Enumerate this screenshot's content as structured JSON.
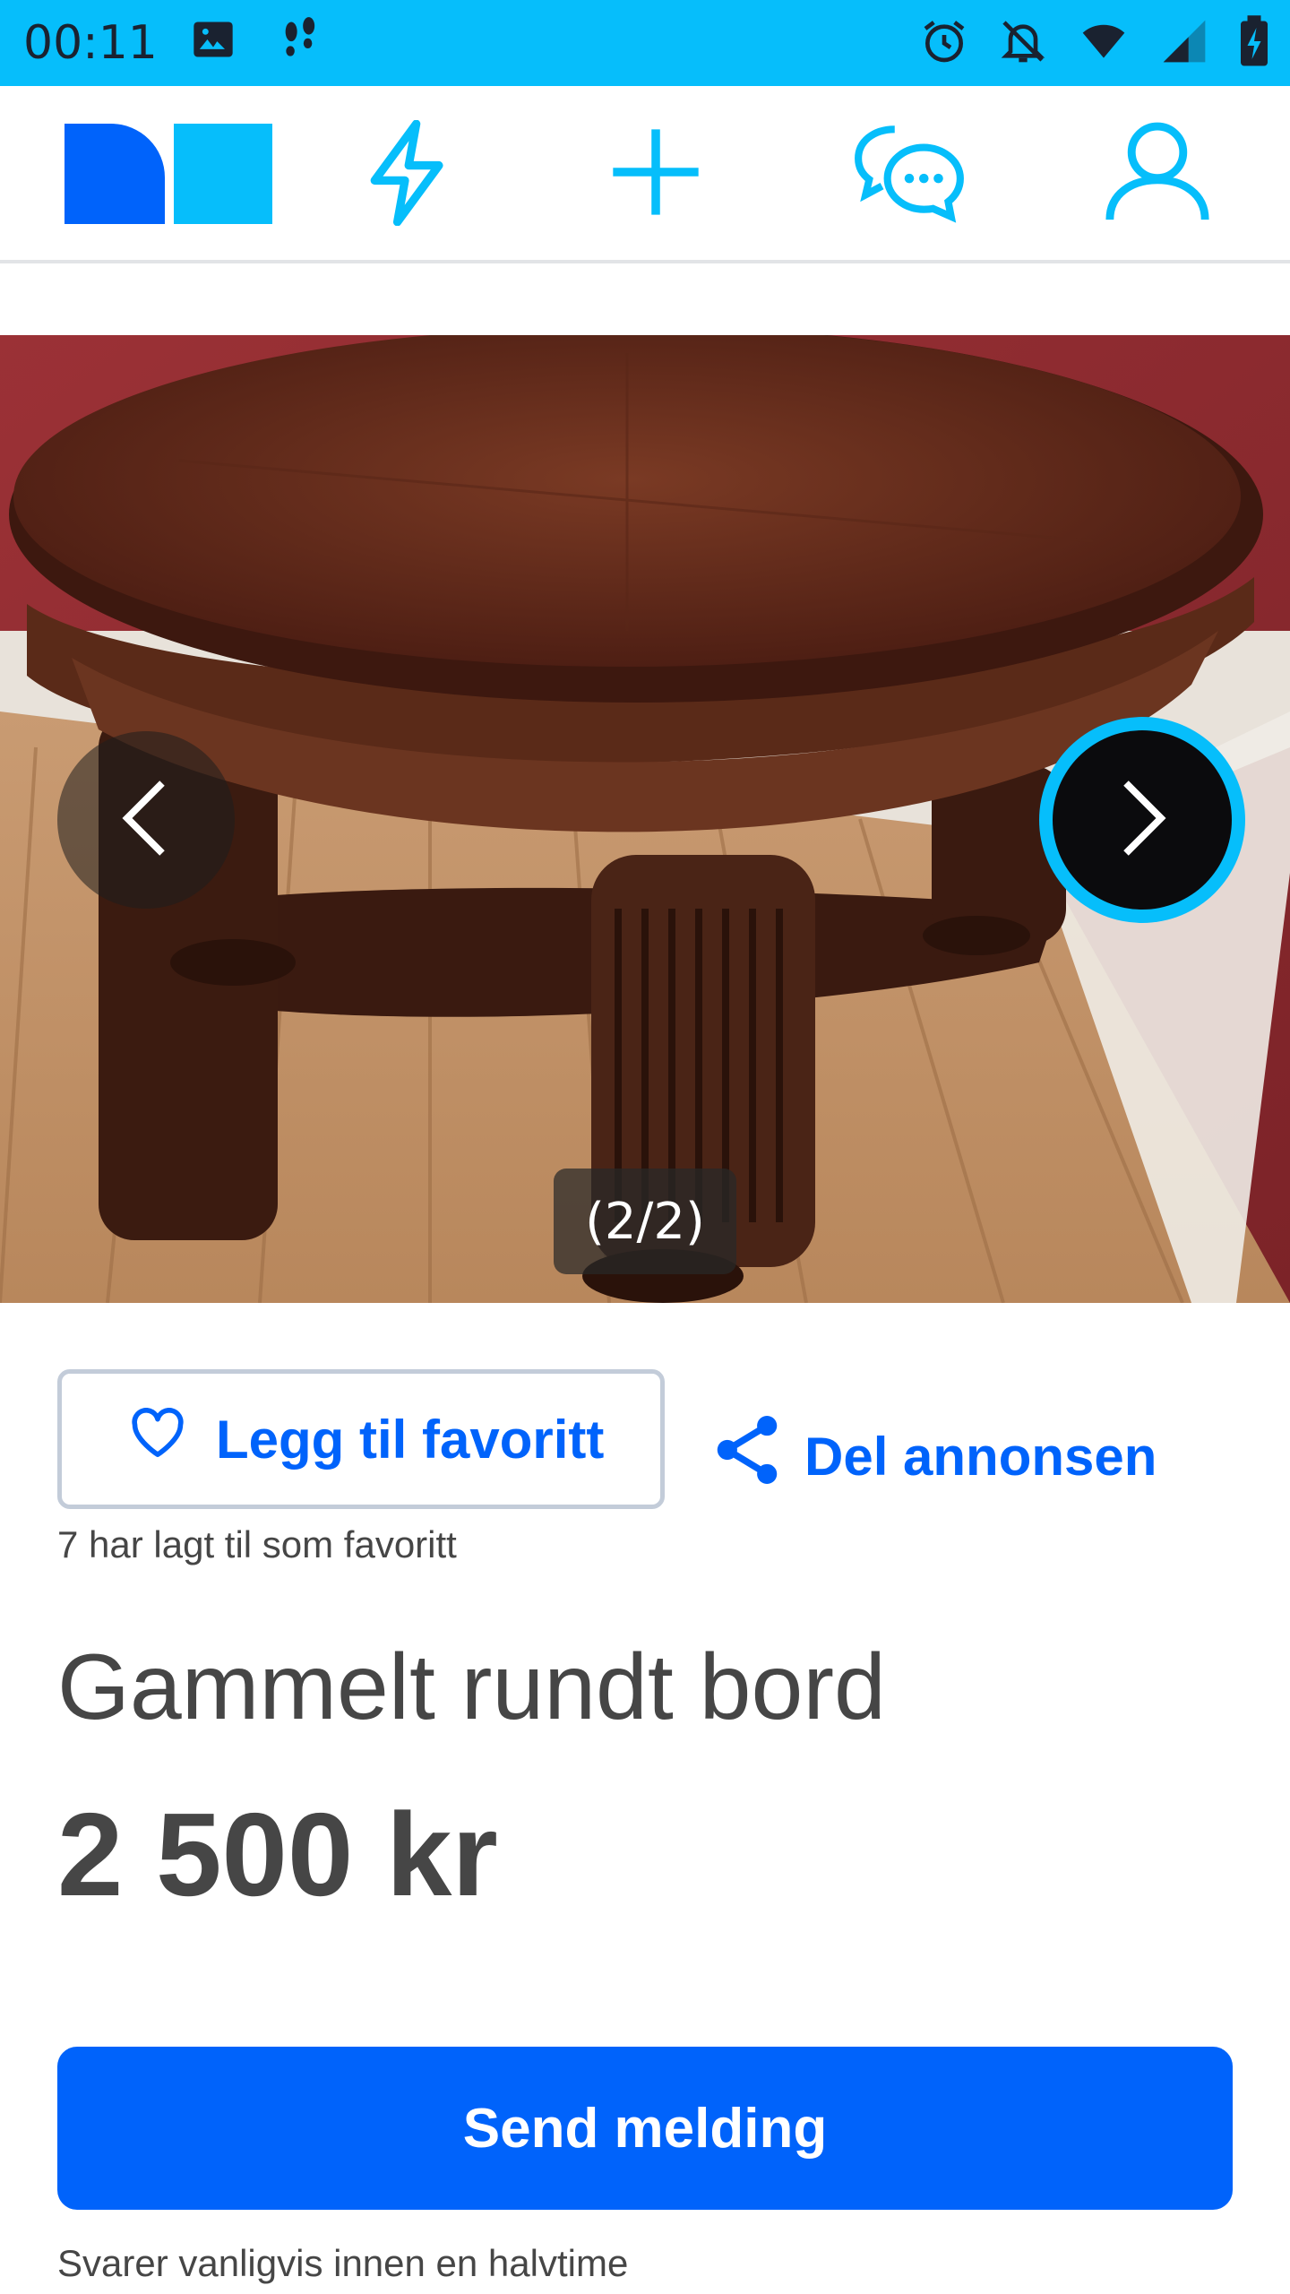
{
  "status_bar": {
    "time": "00:11",
    "left_icons": [
      "image-icon",
      "footsteps-icon"
    ],
    "right_icons": [
      "alarm-icon",
      "notifications-off-icon",
      "wifi-icon",
      "signal-icon",
      "battery-charging-icon"
    ]
  },
  "nav": {
    "items": [
      "home-logo",
      "lightning-icon",
      "plus-icon",
      "messages-icon",
      "profile-icon"
    ],
    "accent_color": "#06befb",
    "logo_colors": [
      "#0063fb",
      "#06befb"
    ]
  },
  "gallery": {
    "counter": "(2/2)",
    "prev_icon": "chevron-left-icon",
    "next_icon": "chevron-right-icon"
  },
  "actions": {
    "favorite_label": "Legg til favoritt",
    "share_label": "Del annonsen",
    "favorite_count_text": "7 har lagt til som favoritt"
  },
  "listing": {
    "title": "Gammelt rundt bord",
    "price": "2 500 kr"
  },
  "contact": {
    "send_label": "Send melding",
    "response_note": "Svarer vanligvis innen en halvtime"
  },
  "colors": {
    "brand_blue": "#0063fb",
    "status_bar": "#06befb",
    "text": "#464646"
  }
}
